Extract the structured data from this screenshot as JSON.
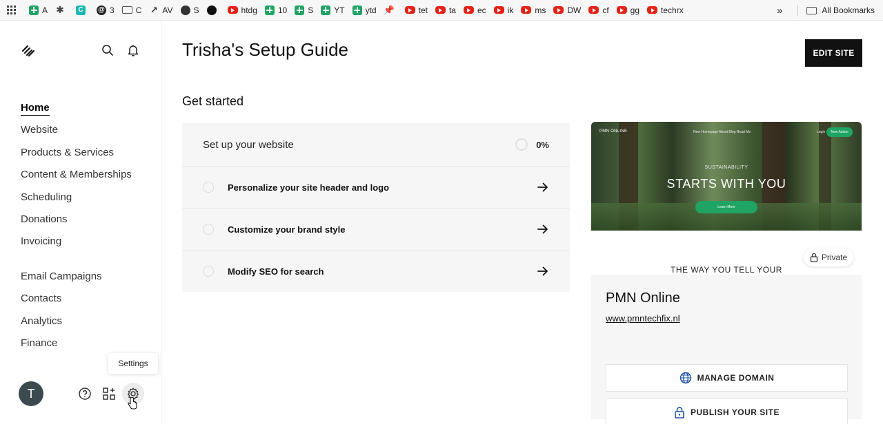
{
  "bookmarks": [
    {
      "icon": "sheets-icon",
      "label": "A"
    },
    {
      "icon": "extension-icon",
      "label": ""
    },
    {
      "icon": "app-icon",
      "label": ""
    },
    {
      "icon": "threads-icon",
      "label": "3"
    },
    {
      "icon": "folder-icon",
      "label": "C"
    },
    {
      "icon": "chart-icon",
      "label": "AV"
    },
    {
      "icon": "globe-icon",
      "label": "S"
    },
    {
      "icon": "github-icon",
      "label": ""
    },
    {
      "icon": "youtube-icon",
      "label": "htdg"
    },
    {
      "icon": "sheets-icon",
      "label": "10"
    },
    {
      "icon": "sheets-icon",
      "label": "S"
    },
    {
      "icon": "sheets-icon",
      "label": "YT"
    },
    {
      "icon": "sheets-icon",
      "label": "ytd"
    },
    {
      "icon": "pin-icon",
      "label": ""
    },
    {
      "icon": "youtube-icon",
      "label": "tet"
    },
    {
      "icon": "youtube-icon",
      "label": "ta"
    },
    {
      "icon": "youtube-icon",
      "label": "ec"
    },
    {
      "icon": "youtube-icon",
      "label": "ik"
    },
    {
      "icon": "youtube-icon",
      "label": "ms"
    },
    {
      "icon": "youtube-icon",
      "label": "DW"
    },
    {
      "icon": "youtube-icon",
      "label": "cf"
    },
    {
      "icon": "youtube-icon",
      "label": "gg"
    },
    {
      "icon": "youtube-icon",
      "label": "techrx"
    }
  ],
  "bookmarks_more": "»",
  "all_bookmarks": "All Bookmarks",
  "sidebar": {
    "nav_primary": [
      "Home",
      "Website",
      "Products & Services",
      "Content & Memberships",
      "Scheduling",
      "Donations",
      "Invoicing"
    ],
    "nav_secondary": [
      "Email Campaigns",
      "Contacts",
      "Analytics",
      "Finance"
    ],
    "avatar_initial": "T",
    "tooltip": "Settings"
  },
  "main": {
    "title": "Trisha's Setup Guide",
    "edit_button": "EDIT SITE",
    "section_title": "Get started",
    "setup": {
      "heading": "Set up your website",
      "progress_label": "0%",
      "progress": 0,
      "tasks": [
        "Personalize your site header and logo",
        "Customize your brand style",
        "Modify SEO for search"
      ]
    },
    "site": {
      "preview": {
        "brand": "PMN ONLINE",
        "links": "New Homepage   About   Blog   Read Me",
        "login": "Login",
        "cta": "New Action",
        "kicker": "SUSTAINABILITY",
        "headline": "STARTS WITH YOU",
        "button": "Learn More",
        "lower_text": "THE WAY YOU TELL YOUR"
      },
      "private_label": "Private",
      "name": "PMN Online",
      "url": "www.pmntechfix.nl",
      "manage_domain": "MANAGE DOMAIN",
      "publish": "PUBLISH YOUR SITE"
    }
  }
}
